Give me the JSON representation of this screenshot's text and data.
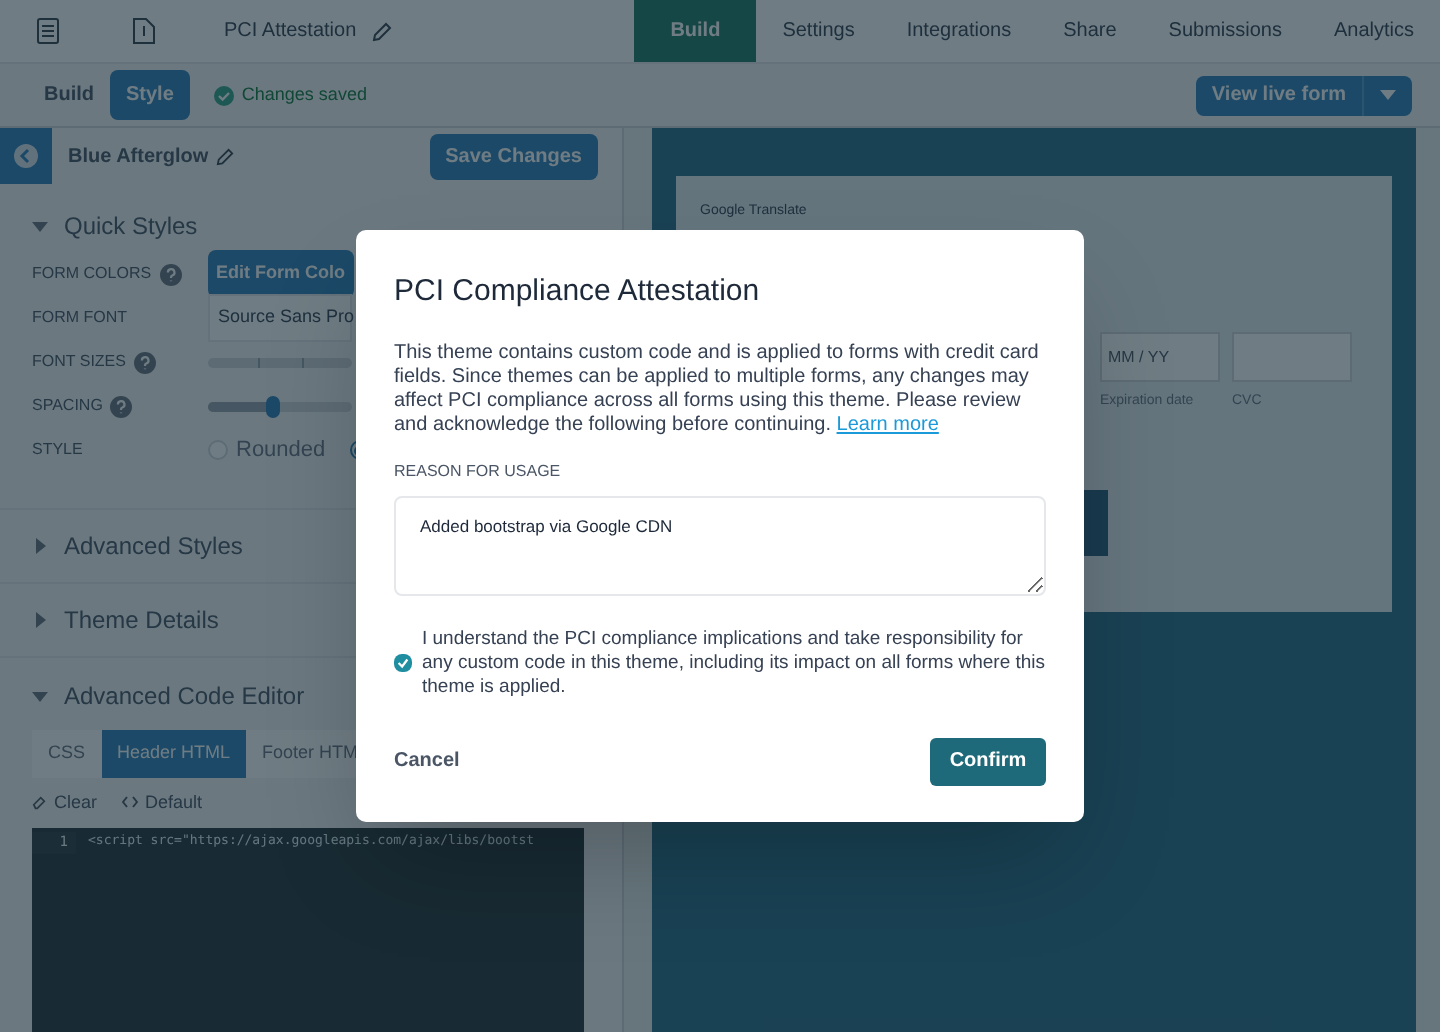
{
  "top_nav": {
    "form_title": "PCI Attestation",
    "tabs": [
      {
        "label": "Build",
        "selected": true
      },
      {
        "label": "Settings",
        "selected": false
      },
      {
        "label": "Integrations",
        "selected": false
      },
      {
        "label": "Share",
        "selected": false
      },
      {
        "label": "Submissions",
        "selected": false
      },
      {
        "label": "Analytics",
        "selected": false
      }
    ]
  },
  "sub_bar": {
    "tabs": [
      {
        "label": "Build",
        "selected": false
      },
      {
        "label": "Style",
        "selected": true
      }
    ],
    "status": "Changes saved",
    "view_button": "View live form"
  },
  "theme_panel": {
    "theme_name": "Blue Afterglow",
    "save_button": "Save Changes",
    "quick_styles": {
      "title": "Quick Styles",
      "expanded": true,
      "rows": [
        {
          "kind": "button",
          "label": "FORM COLORS",
          "help": true,
          "value": "Edit Form Colo"
        },
        {
          "kind": "select",
          "label": "FORM FONT",
          "help": false,
          "value": "Source Sans Pro"
        },
        {
          "kind": "scale",
          "label": "FONT SIZES",
          "help": true
        },
        {
          "kind": "slider",
          "label": "SPACING",
          "help": true,
          "level": 0.45
        },
        {
          "kind": "radio",
          "label": "STYLE",
          "help": false,
          "options": [
            {
              "label": "Rounded",
              "selected": false
            },
            {
              "selected": true
            }
          ]
        }
      ]
    },
    "collapsed_sections": [
      {
        "title": "Advanced Styles",
        "expanded": false
      },
      {
        "title": "Theme Details",
        "expanded": false
      }
    ],
    "code_editor": {
      "title": "Advanced Code Editor",
      "expanded": true,
      "tabs": [
        {
          "label": "CSS",
          "selected": false
        },
        {
          "label": "Header HTML",
          "selected": true
        },
        {
          "label": "Footer HTM",
          "selected": false
        }
      ],
      "actions": [
        "Clear",
        "Default"
      ],
      "lines": [
        {
          "number": "1",
          "code": "<script src=\"https://ajax.googleapis.com/ajax/libs/bootst"
        }
      ]
    }
  },
  "preview": {
    "label": "Google Translate",
    "fields": [
      {
        "placeholder": "MM / YY",
        "caption": "Expiration date"
      },
      {
        "caption": "CVC"
      }
    ]
  },
  "dialog": {
    "title": "PCI Compliance Attestation",
    "body": "This theme contains custom code and is applied to forms with credit card fields. Since themes can be applied to multiple forms, any changes may affect PCI compliance across all forms using this theme. Please review and acknowledge the following before continuing.",
    "link": "Learn more",
    "reason_label": "REASON FOR USAGE",
    "reason_value": "Added bootstrap via Google CDN",
    "acknowledge": {
      "checked": true,
      "text": "I understand the PCI compliance implications and take responsibility for any custom code in this theme, including its impact on all forms where this theme is applied."
    },
    "cancel": "Cancel",
    "confirm": "Confirm"
  }
}
